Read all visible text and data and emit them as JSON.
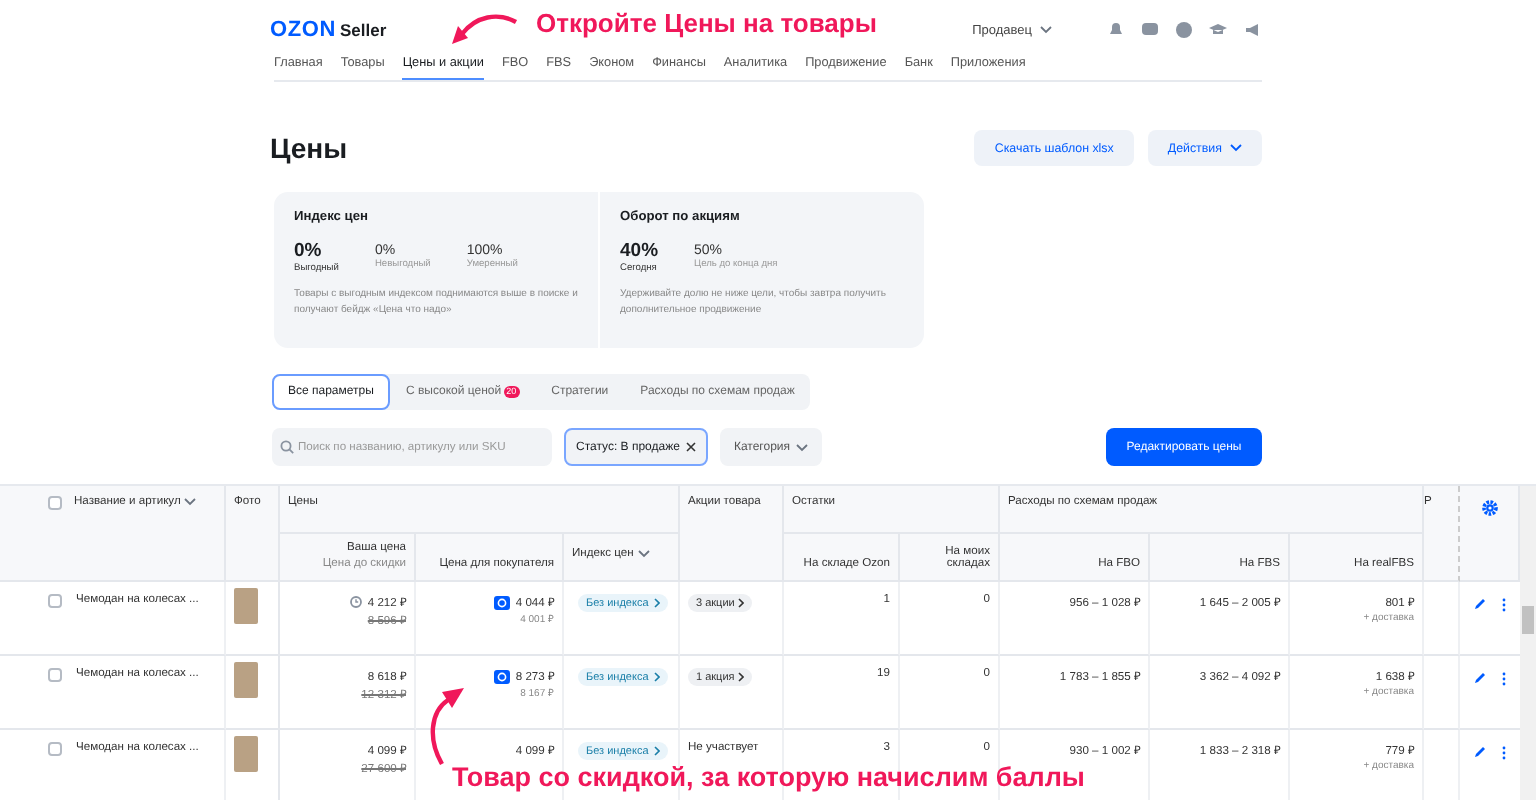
{
  "header": {
    "logo": "OZON",
    "logo_suffix": "Seller",
    "account": "Продавец",
    "nav": [
      {
        "label": "Главная",
        "selected": false
      },
      {
        "label": "Товары",
        "selected": false
      },
      {
        "label": "Цены и акции",
        "selected": true
      },
      {
        "label": "FBO",
        "selected": false
      },
      {
        "label": "FBS",
        "selected": false
      },
      {
        "label": "Эконом",
        "selected": false
      },
      {
        "label": "Финансы",
        "selected": false
      },
      {
        "label": "Аналитика",
        "selected": false
      },
      {
        "label": "Продвижение",
        "selected": false
      },
      {
        "label": "Банк",
        "selected": false
      },
      {
        "label": "Приложения",
        "selected": false
      }
    ]
  },
  "annotations": [
    {
      "text": "Откройте Цены на товары",
      "kind": "top"
    },
    {
      "text": "Товар со скидкой, за которую начислим баллы",
      "kind": "bottom"
    }
  ],
  "page": {
    "title": "Цены",
    "buttons": [
      "Скачать шаблон xlsx",
      "Действия"
    ]
  },
  "summary": [
    {
      "title": "Индекс цен",
      "stats": [
        {
          "value": "0%",
          "label": "Выгодный",
          "highlighted": true
        },
        {
          "value": "0%",
          "label": "Невыгодный",
          "highlighted": false
        },
        {
          "value": "100%",
          "label": "Умеренный",
          "highlighted": false
        }
      ],
      "note": "Товары с выгодным индексом поднимаются выше в поиске и получают бейдж «Цена что надо»"
    },
    {
      "title": "Оборот по акциям",
      "stats": [
        {
          "value": "40%",
          "label": "Сегодня",
          "highlighted": true
        },
        {
          "value": "50%",
          "label": "Цель до конца дня",
          "highlighted": false
        }
      ],
      "note": "Удерживайте долю не ниже цели, чтобы завтра получить дополнительное продвижение"
    }
  ],
  "tabs": [
    {
      "label": "Все параметры",
      "selected": true
    },
    {
      "label": "С высокой ценой",
      "selected": false,
      "badge": "20"
    },
    {
      "label": "Стратегии",
      "selected": false
    },
    {
      "label": "Расходы по схемам продаж",
      "selected": false
    }
  ],
  "filters": {
    "search": {
      "placeholder": "Поиск по названию, артикулу или SKU"
    },
    "status_chip": "Статус: В продаже",
    "category": "Категория",
    "edit_button": "Редактировать цены"
  },
  "table": {
    "columns": {
      "name": "Название и артикул",
      "photo": "Фото",
      "prices": "Цены",
      "your_price": "Ваша цена",
      "price_before_discount": "Цена до скидки",
      "buyer_price": "Цена для покупателя",
      "price_index": "Индекс цен",
      "promotions": "Акции товара",
      "stock": "Остатки",
      "stock_ozon": "На складе Ozon",
      "stock_own": "На моих складах",
      "expenses": "Расходы по схемам продаж",
      "fbo": "На FBO",
      "fbs": "На FBS",
      "realfbs": "На realFBS",
      "column_12": "Р"
    },
    "select_all_checked": false,
    "rows": [
      {
        "name": "Чемодан на колесах ...",
        "checked": false,
        "price_marked": true,
        "price": "4 212 ₽",
        "old_price": "8 596 ₽",
        "card_price": true,
        "buyer_price": "4 044 ₽",
        "buyer_price_sub": "4 001 ₽",
        "index": "Без индекса",
        "promo": {
          "text": "3 акции",
          "kind": "chip"
        },
        "stock_ozon": "1",
        "stock_own": "0",
        "fbo": "956 – 1 028 ₽",
        "fbs": "1 645 – 2 005 ₽",
        "realfbs": "801 ₽",
        "realfbs_note": "+ доставка"
      },
      {
        "name": "Чемодан на колесах ...",
        "checked": false,
        "price_marked": false,
        "price": "8 618 ₽",
        "old_price": "12 312 ₽",
        "card_price": true,
        "buyer_price": "8 273 ₽",
        "buyer_price_sub": "8 167 ₽",
        "index": "Без индекса",
        "promo": {
          "text": "1 акция",
          "kind": "chip"
        },
        "stock_ozon": "19",
        "stock_own": "0",
        "fbo": "1 783 – 1 855 ₽",
        "fbs": "3 362 – 4 092 ₽",
        "realfbs": "1 638 ₽",
        "realfbs_note": "+ доставка"
      },
      {
        "name": "Чемодан на колесах ...",
        "checked": false,
        "price_marked": false,
        "price": "4 099 ₽",
        "old_price": "27 600 ₽",
        "card_price": false,
        "buyer_price": "4 099 ₽",
        "index": "Без индекса",
        "promo": {
          "text": "Не участвует",
          "kind": "plain"
        },
        "stock_ozon": "3",
        "stock_own": "0",
        "fbo": "930 – 1 002 ₽",
        "fbs": "1 833 – 2 318 ₽",
        "realfbs": "779 ₽",
        "realfbs_note": "+ доставка"
      }
    ]
  }
}
